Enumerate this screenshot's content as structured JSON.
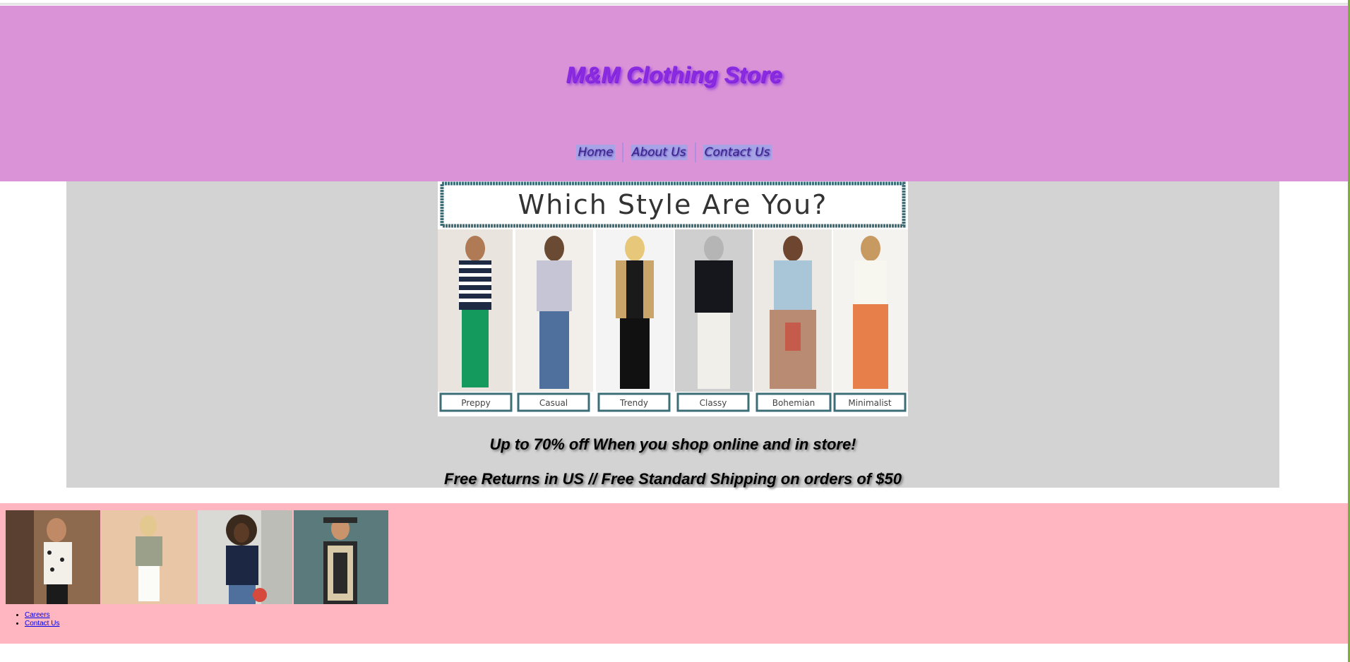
{
  "header": {
    "title": "M&M Clothing Store",
    "nav": [
      "Home",
      "About Us",
      "Contact Us"
    ]
  },
  "hero": {
    "image_heading": "Which Style Are You?",
    "styles": [
      "Preppy",
      "Casual",
      "Trendy",
      "Classy",
      "Bohemian",
      "Minimalist"
    ],
    "promo_1": "Up to 70% off When you shop online and in store!",
    "promo_2": "Free Returns in US // Free Standard Shipping on orders of $50"
  },
  "footer": {
    "links": [
      "Careers",
      "Contact Us"
    ]
  },
  "colors": {
    "header_bg": "#da93d6",
    "title": "#8a2be2",
    "hero_bg": "#d3d3d3",
    "footer_bg": "#ffb6c1"
  }
}
